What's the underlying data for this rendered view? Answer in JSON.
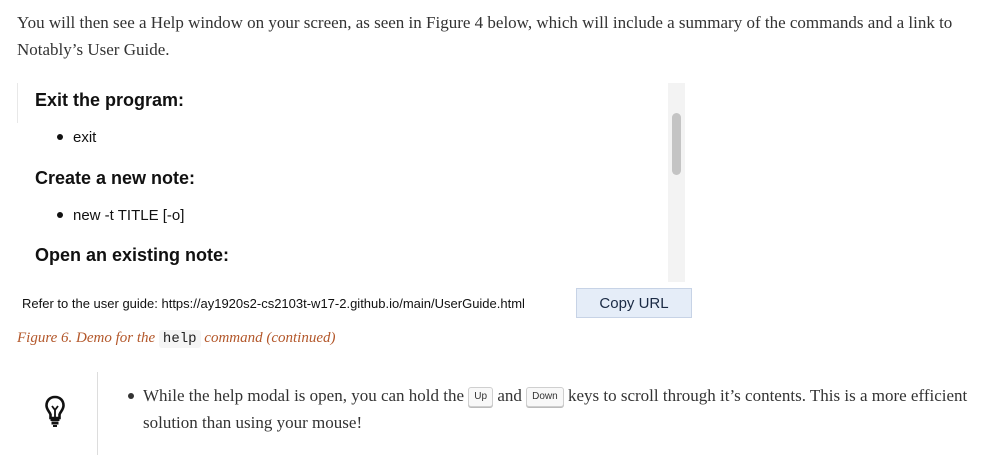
{
  "intro": {
    "text": "You will then see a Help window on your screen, as seen in Figure 4 below, which will include a summary of the commands and a link to Notably’s User Guide."
  },
  "help_window": {
    "sections": [
      {
        "heading": "Exit the program:",
        "command": "exit"
      },
      {
        "heading": "Create a new note:",
        "command": "new -t TITLE [-o]"
      },
      {
        "heading": "Open an existing note:"
      }
    ],
    "guide_text": "Refer to the user guide: https://ay1920s2-cs2103t-w17-2.github.io/main/UserGuide.html",
    "copy_button": "Copy URL",
    "scroll_position": 0.22
  },
  "caption": {
    "prefix": "Figure 6. Demo for the",
    "code": "help",
    "suffix": "command (continued)"
  },
  "tip": {
    "icon": "lightbulb-icon",
    "before_up": "While the help modal is open, you can hold the",
    "key_up": "Up",
    "between": "and",
    "key_down": "Down",
    "after_down": "keys to scroll through it’s contents. This is a more efficient solution than using your mouse!"
  }
}
